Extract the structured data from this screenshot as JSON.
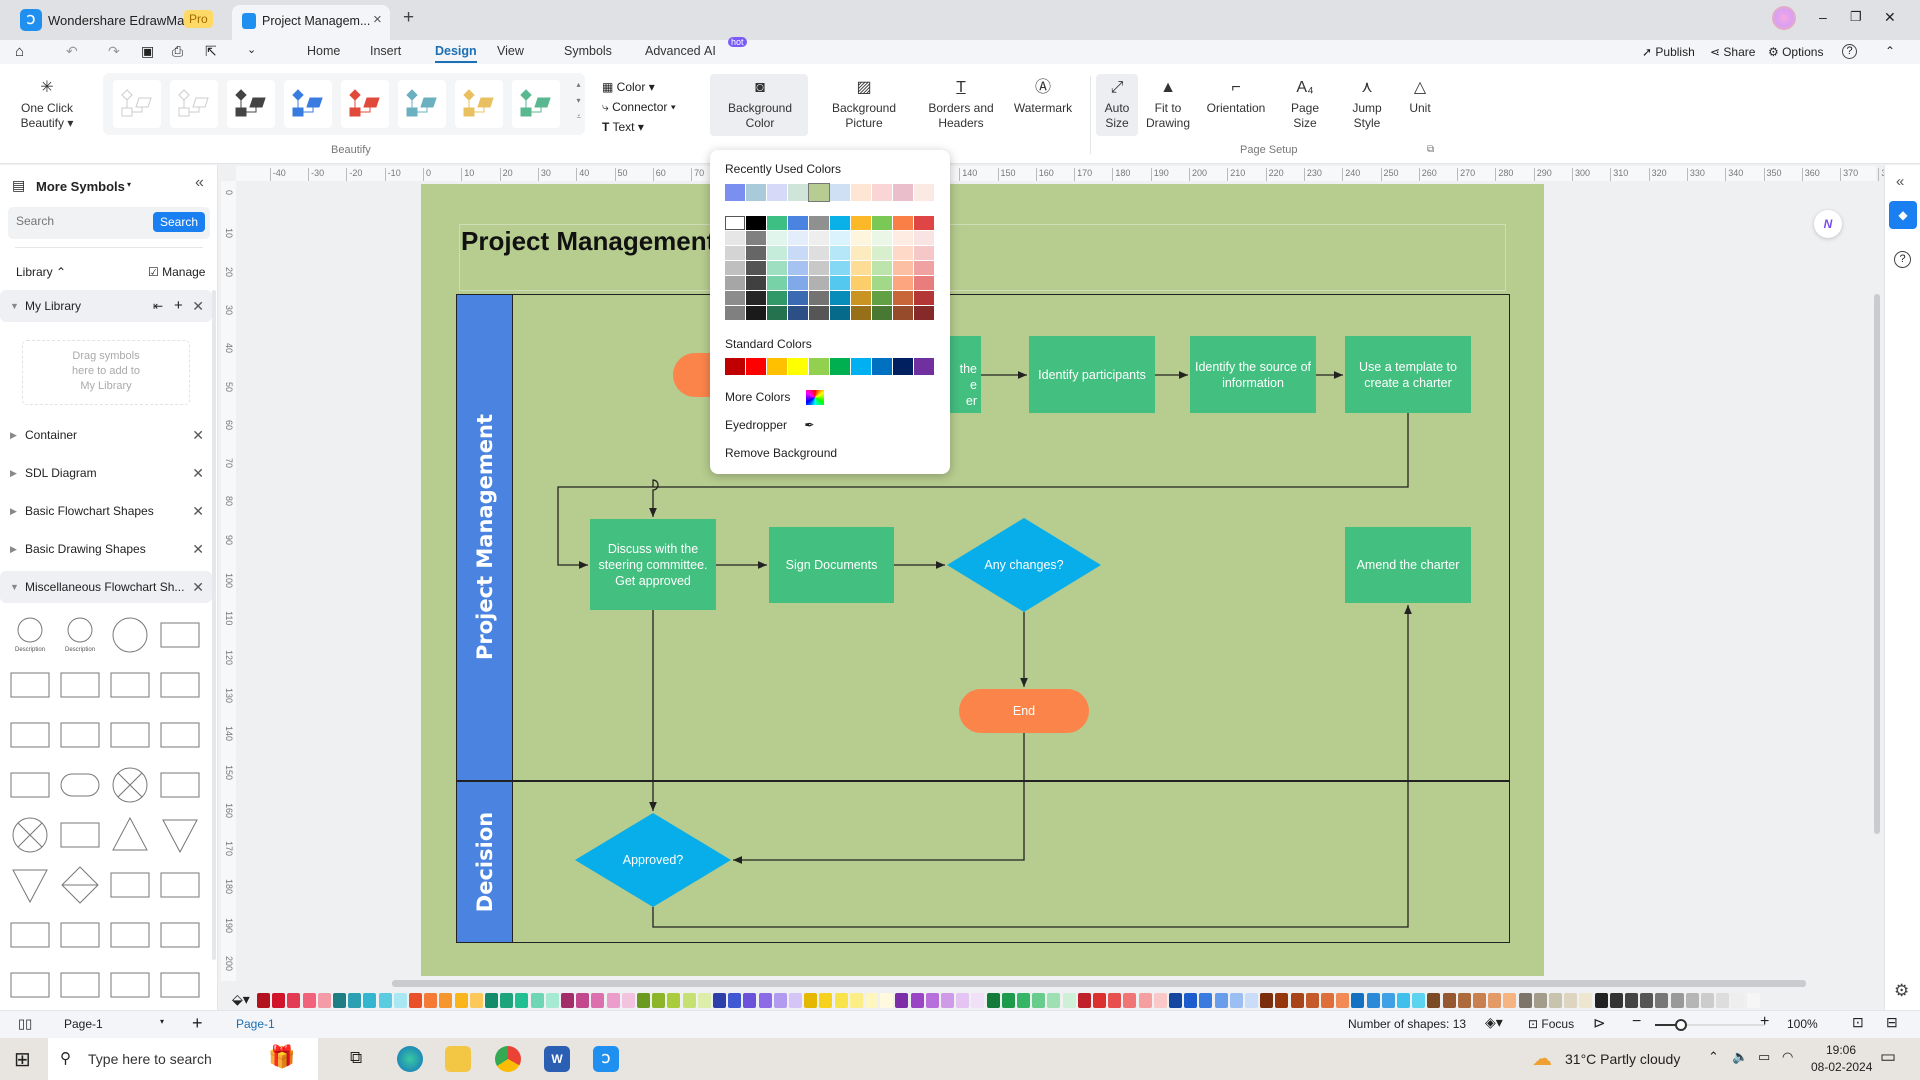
{
  "titlebar": {
    "app_name": "Wondershare EdrawMax",
    "badge": "Pro",
    "doc_tab": "Project Managem...",
    "close": "×",
    "new_tab": "+",
    "minimize": "–",
    "restore": "❐",
    "close_window": "✕"
  },
  "menubar": {
    "tabs": [
      "Home",
      "Insert",
      "Design",
      "View",
      "Symbols",
      "Advanced",
      "AI"
    ],
    "active_tab": "Design",
    "ai_badge": "hot",
    "publish": "Publish",
    "share": "Share",
    "options": "Options",
    "help": "?"
  },
  "ribbon": {
    "one_click": [
      "One Click",
      "Beautify"
    ],
    "beautify_group": "Beautify",
    "format_items": [
      "Color",
      "Connector",
      "Text"
    ],
    "buttons": [
      {
        "label": [
          "Background",
          "Color"
        ],
        "icon": "background-color-icon"
      },
      {
        "label": [
          "Background",
          "Picture"
        ],
        "icon": "background-picture-icon"
      },
      {
        "label": [
          "Borders and",
          "Headers"
        ],
        "icon": "borders-headers-icon"
      },
      {
        "label": [
          "Watermark",
          ""
        ],
        "icon": "watermark-icon"
      },
      {
        "label": [
          "Auto",
          "Size"
        ],
        "icon": "auto-size-icon"
      },
      {
        "label": [
          "Fit to",
          "Drawing"
        ],
        "icon": "fit-drawing-icon"
      },
      {
        "label": [
          "Orientation",
          ""
        ],
        "icon": "orientation-icon"
      },
      {
        "label": [
          "Page",
          "Size"
        ],
        "icon": "page-size-icon"
      },
      {
        "label": [
          "Jump",
          "Style"
        ],
        "icon": "jump-style-icon"
      },
      {
        "label": [
          "Unit",
          ""
        ],
        "icon": "unit-icon"
      }
    ],
    "page_setup_group": "Page Setup"
  },
  "sidebar": {
    "title": "More Symbols",
    "search_placeholder": "Search",
    "search_button": "Search",
    "library": "Library",
    "manage": "Manage",
    "my_library": "My Library",
    "drop_hint": [
      "Drag symbols",
      "here to add to",
      "My Library"
    ],
    "libraries": [
      "Container",
      "SDL Diagram",
      "Basic Flowchart Shapes",
      "Basic Drawing Shapes",
      "Miscellaneous Flowchart Sh..."
    ],
    "shape_captions": [
      "Description",
      "Description"
    ]
  },
  "rulers": {
    "h_start": -50,
    "h_end": 380,
    "v_start": 0,
    "v_end": 200,
    "step": 10
  },
  "diagram": {
    "title": "Project Management",
    "lanes": [
      "Project Management",
      "Decision"
    ],
    "partial_box": [
      "the",
      "e",
      "er"
    ],
    "nodes": {
      "identify_participants": "Identify participants",
      "identify_source": "Identify the source of information",
      "use_template": "Use a template to create a charter",
      "discuss": "Discuss with the steering committee. Get approved",
      "sign": "Sign Documents",
      "any_changes": "Any changes?",
      "amend": "Amend the charter",
      "end": "End",
      "approved": "Approved?"
    },
    "colors": {
      "page": "#b7cc8f",
      "lane_header": "#4a84e0",
      "process": "#43bf7f",
      "decision": "#07aee9",
      "terminator": "#fb844b"
    }
  },
  "color_popup": {
    "recent_label": "Recently Used Colors",
    "recent": [
      "#7b8ff0",
      "#a9cbd9",
      "#d6d9f7",
      "#cfe5d9",
      "#b7cc91",
      "#cfe0f4",
      "#fde7d4",
      "#fbd5d5",
      "#ebbecb",
      "#fbe9e3"
    ],
    "selected_recent": "#b7cc91",
    "theme": [
      "#ffffff",
      "#000000",
      "#3dbe82",
      "#4a84e0",
      "#909090",
      "#0ab0e8",
      "#fbb92a",
      "#7ac855",
      "#fa7f47",
      "#e04545"
    ],
    "standard_label": "Standard Colors",
    "standard": [
      "#c00000",
      "#ff0000",
      "#ffc000",
      "#ffff00",
      "#92d050",
      "#00b050",
      "#00b0f0",
      "#0070c0",
      "#002060",
      "#7030a0"
    ],
    "more_colors": "More Colors",
    "eyedropper": "Eyedropper",
    "remove_background": "Remove Background"
  },
  "palette": [
    "#b3121f",
    "#d0142c",
    "#e23a53",
    "#f0637a",
    "#f59aa7",
    "#1f7d84",
    "#2aa0b2",
    "#35b6d0",
    "#5bcbe0",
    "#a9e8f2",
    "#e9502a",
    "#f47a35",
    "#f7962c",
    "#fbb51c",
    "#fcc85a",
    "#138a6a",
    "#1ca47d",
    "#22bf92",
    "#6fd6b5",
    "#a6ead4",
    "#a22d68",
    "#c2478c",
    "#dc6fae",
    "#eb9dcc",
    "#f2c3df",
    "#6a9a20",
    "#8db52a",
    "#a9cc3d",
    "#c6e071",
    "#ddeeab",
    "#2d3fa8",
    "#3f58d3",
    "#6b52d8",
    "#8c6be6",
    "#b29af0",
    "#d4c5f6",
    "#e5b800",
    "#f7d21d",
    "#f9e34a",
    "#fbee86",
    "#fdf6c0",
    "#fff9de",
    "#7b2ea8",
    "#9a44c6",
    "#b66fdb",
    "#cf9ae8",
    "#e4c4f2",
    "#f0e0f8",
    "#137a3a",
    "#1e9a4c",
    "#35b565",
    "#68cc8c",
    "#9fe0b3",
    "#cdf0d7",
    "#c0202a",
    "#dc3030",
    "#e85050",
    "#f07676",
    "#f5a0a0",
    "#fac8c8",
    "#1446a0",
    "#1c5ccc",
    "#3a7be0",
    "#6a9cec",
    "#9cbff3",
    "#c9dcf8",
    "#7a2e0c",
    "#95360c",
    "#a8441a",
    "#c45a2a",
    "#de6e3a",
    "#f28a55",
    "#1470c0",
    "#2b8ad8",
    "#3fa0e6",
    "#3fc0ec",
    "#5cd4f0",
    "#7a4a26",
    "#955830",
    "#ad6a3c",
    "#c98050",
    "#e49a66",
    "#f5b482",
    "#7d746a",
    "#a49c8a",
    "#c8c3ad",
    "#ddd5c0",
    "#efe6cf",
    "#222222",
    "#333333",
    "#444444",
    "#555555",
    "#777777",
    "#999999",
    "#b5b5b5",
    "#cccccc",
    "#dddddd",
    "#eeeeee",
    "#f6f6f6"
  ],
  "statusbar": {
    "page_select": "Page-1",
    "page_tab": "Page-1",
    "add_page": "+",
    "shape_count": "Number of shapes: 13",
    "focus": "Focus",
    "zoom": "100%"
  },
  "taskbar": {
    "search_placeholder": "Type here to search",
    "weather": "31°C  Partly cloudy",
    "time": "19:06",
    "date": "08-02-2024"
  }
}
